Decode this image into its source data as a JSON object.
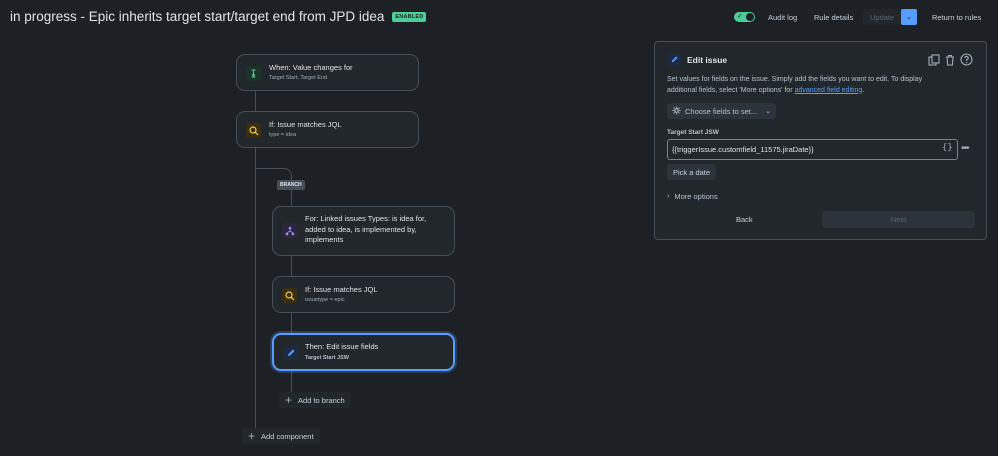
{
  "header": {
    "title": "in progress - Epic inherits target start/target end from JPD idea",
    "status_badge": "ENABLED",
    "audit_log": "Audit log",
    "rule_details": "Rule details",
    "update": "Update",
    "return_to_rules": "Return to rules"
  },
  "flow": {
    "trigger": {
      "title": "When: Value changes for",
      "subtitle": "Target Start, Target End"
    },
    "condition1": {
      "title": "If: Issue matches JQL",
      "subtitle": "type = idea"
    },
    "branch_tag": "BRANCH",
    "branch": {
      "title": "For: Linked issues Types: is idea for, added to idea, is implemented by, implements"
    },
    "condition2": {
      "title": "If: Issue matches JQL",
      "subtitle": "issuetype = epic"
    },
    "action": {
      "title": "Then: Edit issue fields",
      "subtitle": "Target Start JSW"
    },
    "add_to_branch": "Add to branch",
    "add_component": "Add component"
  },
  "panel": {
    "title": "Edit issue",
    "description_1": "Set values for fields on the issue. Simply add the fields you want to edit. To display additional fields, select 'More options' for ",
    "description_link": "advanced field editing",
    "description_2": ".",
    "choose_fields": "Choose fields to set...",
    "field_label": "Target Start JSW",
    "field_value": "{{triggerIssue.customfield_11575.jiraDate}}",
    "pick_date": "Pick a date",
    "more_options": "More options",
    "back": "Back",
    "next": "Next"
  },
  "colors": {
    "accent": "#579dff",
    "enabled": "#4bce97",
    "background": "#1d2125"
  }
}
